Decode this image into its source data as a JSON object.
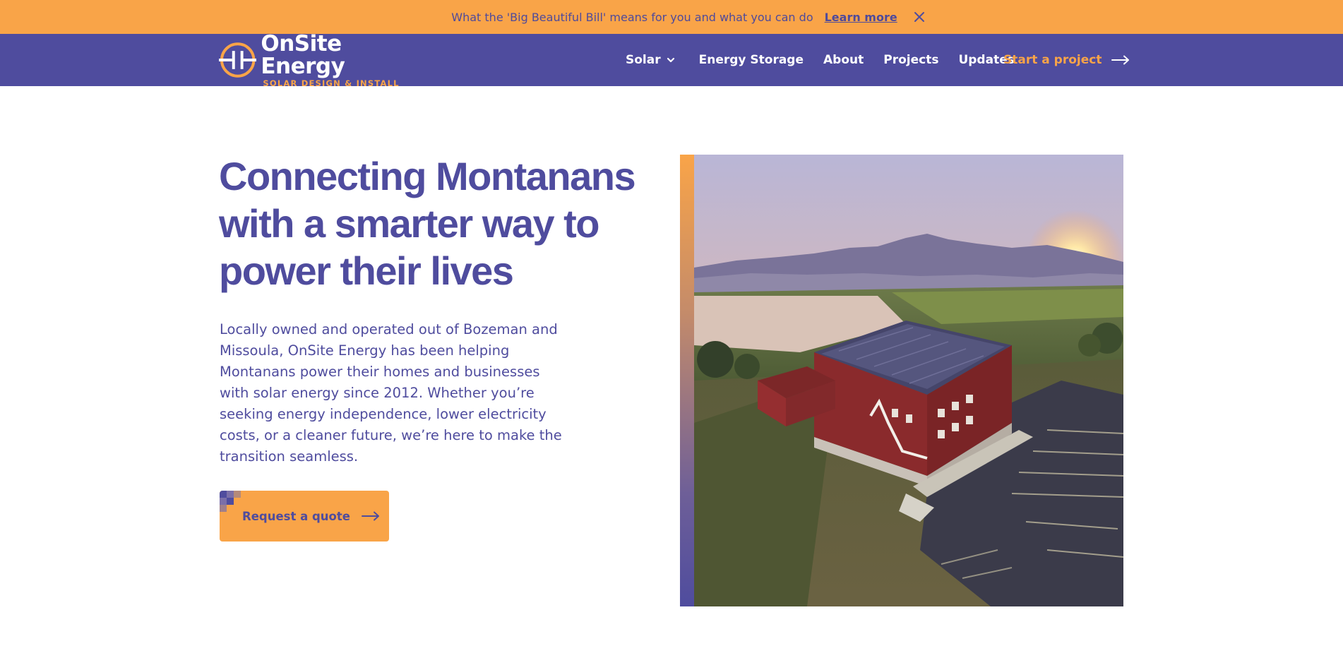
{
  "announcement": {
    "text": "What the 'Big Beautiful Bill' means for you and what you can do",
    "link_label": "Learn more"
  },
  "brand": {
    "name": "OnSite Energy",
    "tagline": "SOLAR DESIGN & INSTALL"
  },
  "nav": {
    "items": [
      {
        "label": "Solar"
      },
      {
        "label": "Energy Storage"
      },
      {
        "label": "About"
      },
      {
        "label": "Projects"
      },
      {
        "label": "Updates"
      }
    ],
    "cta_label": "Start a project"
  },
  "hero": {
    "title": "Connecting Montanans with a smarter way to power their lives",
    "body": "Locally owned and operated out of Bozeman and Missoula, OnSite Energy has been helping Montanans power their homes and businesses with solar energy since 2012. Whether you’re seeking energy independence, lower electricity costs, or a cleaner future, we’re here to make the transition seamless.",
    "button_label": "Request a quote"
  },
  "colors": {
    "primary": "#4f4c9e",
    "accent": "#f9a448",
    "background": "#ffffff"
  },
  "icons": {
    "close": "close-icon",
    "chevron": "chevron-down-icon",
    "arrow": "arrow-right-icon",
    "logo": "logo-mark-icon"
  }
}
